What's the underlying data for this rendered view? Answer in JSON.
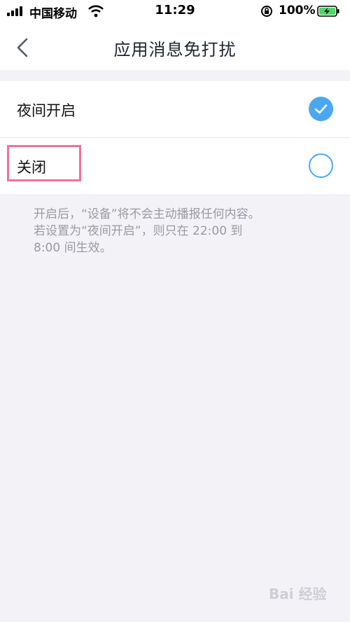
{
  "status_bar": {
    "carrier": "中国移动",
    "time": "11:29",
    "battery_percent": "100%",
    "icons": [
      "signal-icon",
      "wifi-icon",
      "rotation-lock-icon",
      "battery-charging-icon"
    ]
  },
  "nav": {
    "title": "应用消息免打扰",
    "back_icon": "chevron-left-icon"
  },
  "options": [
    {
      "label": "夜间开启",
      "selected": true
    },
    {
      "label": "关闭",
      "selected": false
    }
  ],
  "hint": {
    "line1": "开启后，“设备”将不会主动播报任何内容。",
    "line2": "若设置为“夜间开启”，则只在 22:00 到",
    "line3": "8:00 间生效。"
  },
  "watermark": "Bai 经验",
  "colors": {
    "accent": "#4aa8f2",
    "highlight": "#f0719a",
    "background": "#f2f2f7"
  }
}
